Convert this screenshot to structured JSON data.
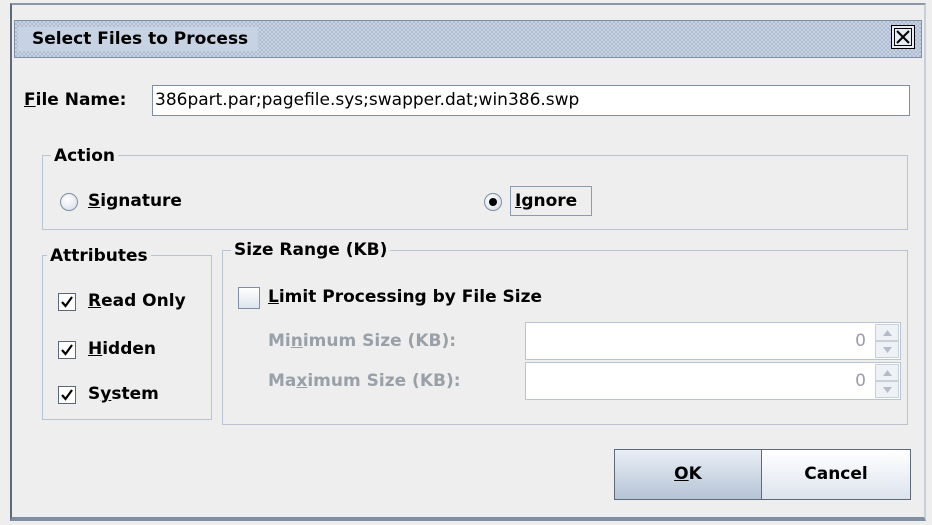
{
  "dialog": {
    "title": "Select Files to Process"
  },
  "file_name": {
    "label_mnemonic": "F",
    "label_rest": "ile Name:",
    "value": "386part.par;pagefile.sys;swapper.dat;win386.swp"
  },
  "action": {
    "legend": "Action",
    "signature": {
      "mnemonic": "S",
      "rest": "ignature",
      "selected": false
    },
    "ignore": {
      "mnemonic": "I",
      "rest": "gnore",
      "selected": true
    }
  },
  "attributes": {
    "legend": "Attributes",
    "read_only": {
      "mnemonic": "R",
      "rest": "ead Only",
      "checked": true
    },
    "hidden": {
      "mnemonic": "H",
      "rest": "idden",
      "checked": true
    },
    "system": {
      "pre": "S",
      "mnemonic": "y",
      "rest": "stem",
      "checked": true
    }
  },
  "size_range": {
    "legend": "Size Range (KB)",
    "limit": {
      "mnemonic": "L",
      "rest": "imit Processing by File Size",
      "checked": false
    },
    "minimum": {
      "pre": "Mi",
      "mnemonic": "n",
      "rest": "imum Size (KB):",
      "value": "0"
    },
    "maximum": {
      "pre": "Ma",
      "mnemonic": "x",
      "rest": "imum Size (KB):",
      "value": "0"
    }
  },
  "buttons": {
    "ok": {
      "mnemonic": "O",
      "rest": "K"
    },
    "cancel": "Cancel"
  }
}
